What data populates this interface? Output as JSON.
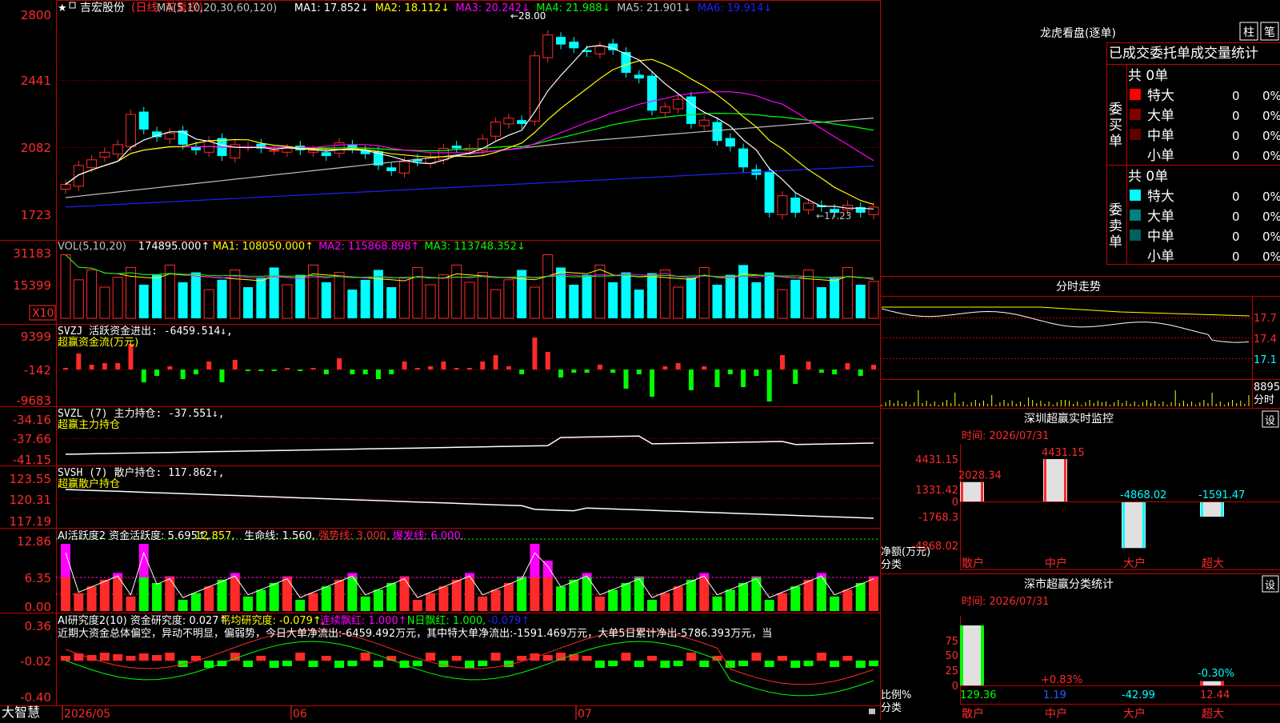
{
  "app": {
    "name": "大智慧",
    "star": "★"
  },
  "title": {
    "stock": "吉宏股份",
    "period": "(日线, 前复权)"
  },
  "dates": {
    "a": "2026/05",
    "b": "06",
    "c": "07"
  },
  "colors": {
    "up": "#ff2a2a",
    "down": "#00ffff",
    "green": "#00ff00",
    "white": "#ffffff",
    "yellow": "#ffff00",
    "magenta": "#ff00ff",
    "blue": "#2020ff",
    "grid": "#c00000",
    "grey": "#c0c0c0"
  },
  "main": {
    "legend": [
      {
        "text": "MA(5,10,20,30,60,120)",
        "color": "#c0c0c0"
      },
      {
        "text": "MA1: 17.852↓",
        "color": "#ffffff"
      },
      {
        "text": "MA2: 18.112↓",
        "color": "#ffff00"
      },
      {
        "text": "MA3: 20.242↓",
        "color": "#ff00ff"
      },
      {
        "text": "MA4: 21.988↓",
        "color": "#00ff00"
      },
      {
        "text": "MA5: 21.901↓",
        "color": "#c0c0c0"
      },
      {
        "text": "MA6: 19.914↓",
        "color": "#2020ff"
      }
    ],
    "yticks": [
      "2800",
      "2441",
      "2082",
      "1723"
    ],
    "high_label": "←28.00",
    "low_label": "←17.23"
  },
  "vol": {
    "legend": [
      {
        "text": "VOL(5,10,20)",
        "color": "#c0c0c0"
      },
      {
        "text": "174895.000↑",
        "color": "#ffffff"
      },
      {
        "text": "MA1: 108050.000↑",
        "color": "#ffff00"
      },
      {
        "text": "MA2: 115868.898↑",
        "color": "#ff00ff"
      },
      {
        "text": "MA3: 113748.352↓",
        "color": "#00ff00"
      }
    ],
    "yticks": [
      "31183",
      "15399"
    ],
    "unit": "X10"
  },
  "svzj": {
    "legend1": [
      {
        "text": "SVZJ  活跃资金进出: -6459.514↓,",
        "color": "#ffffff"
      }
    ],
    "legend2": "超赢资金流(万元)",
    "yticks": [
      "9399",
      "-142",
      "-9683"
    ]
  },
  "svzl": {
    "legend1": [
      {
        "text": "SVZL (7) 主力持仓: -37.551↓,",
        "color": "#ffffff"
      }
    ],
    "legend2": "超赢主力持仓",
    "yticks": [
      "-34.16",
      "-37.66",
      "-41.15"
    ]
  },
  "svsh": {
    "legend1": [
      {
        "text": "SVSH (7) 散户持仓: 117.862↑,",
        "color": "#ffffff"
      }
    ],
    "legend2": "超赢散户持仓",
    "yticks": [
      "123.55",
      "120.31",
      "117.19"
    ]
  },
  "ai1": {
    "legend": [
      {
        "text": "AI活跃度2 资金活跃度: 5.695↑,",
        "color": "#ffffff"
      },
      {
        "text": "12.857,",
        "color": "#ffff00"
      },
      {
        "text": "生命线: 1.560,",
        "color": "#ffffff"
      },
      {
        "text": "强势线: 3.000,",
        "color": "#ff2a2a"
      },
      {
        "text": "爆发线: 6.000,",
        "color": "#ff00ff"
      }
    ],
    "yticks": [
      "12.86",
      "6.35",
      "0.00"
    ]
  },
  "ai2": {
    "legend": [
      {
        "text": "AI研究度2(10) 资金研究度: 0.027↑,",
        "color": "#ffffff"
      },
      {
        "text": "平均研究度: -0.079↑,",
        "color": "#ffff00"
      },
      {
        "text": "连续飘红: 1.000↑,",
        "color": "#ff00ff"
      },
      {
        "text": "N日飘红: 1.000,",
        "color": "#00ff00"
      },
      {
        "text": "-0.079↑",
        "color": "#2020ff"
      }
    ],
    "text": "近期大资金总体偏空，异动不明显，偏弱势，今日大单净流出:-6459.492万元，其中特大单净流出:-1591.469万元，大单5日累计净出-5786.393万元，当",
    "yticks": [
      "0.36",
      "-0.02",
      "-0.40"
    ]
  },
  "lhb": {
    "title": "龙虎看盘(逐单)",
    "btn1": "柱",
    "btn2": "笔",
    "header": "已成交委托单成交量统计",
    "buy": {
      "label": "委买单",
      "total": "共 0单",
      "rows": [
        {
          "name": "特大",
          "v": "0",
          "p": "0%",
          "c": "#ff0000"
        },
        {
          "name": "大单",
          "v": "0",
          "p": "0%",
          "c": "#800000"
        },
        {
          "name": "中单",
          "v": "0",
          "p": "0%",
          "c": "#600000"
        },
        {
          "name": "小单",
          "v": "0",
          "p": "0%",
          "c": "#000000"
        }
      ]
    },
    "sell": {
      "label": "委卖单",
      "total": "共 0单",
      "rows": [
        {
          "name": "特大",
          "v": "0",
          "p": "0%",
          "c": "#00ffff"
        },
        {
          "name": "大单",
          "v": "0",
          "p": "0%",
          "c": "#008080"
        },
        {
          "name": "中单",
          "v": "0",
          "p": "0%",
          "c": "#006060"
        },
        {
          "name": "小单",
          "v": "0",
          "p": "0%",
          "c": "#000000"
        }
      ]
    }
  },
  "intraday": {
    "title": "分时走势",
    "p1": "17.7",
    "p2": "17.4",
    "p3": "17.1",
    "vol": "8895",
    "vlabel": "分时"
  },
  "szjk": {
    "title": "深圳超赢实时监控",
    "btn": "设",
    "time": "时间: 2026/07/31",
    "yticks": [
      "4431.15",
      "1331.42",
      "0",
      "-1768.3",
      "-4868.02"
    ],
    "ylabel": "净额(万元)",
    "xlabel": "分类",
    "cats": [
      "散户",
      "中户",
      "大户",
      "超大"
    ],
    "vals": [
      "2028.34",
      "4431.15",
      "-4868.02",
      "-1591.47"
    ]
  },
  "fltj": {
    "title": "深市超赢分类统计",
    "btn": "设",
    "time": "时间: 2026/07/31",
    "yticks": [
      "75",
      "50",
      "25",
      "0"
    ],
    "ylabel": "比例%",
    "xlabel": "分类",
    "cats": [
      "散户",
      "中户",
      "大户",
      "超大"
    ],
    "pct": [
      "",
      "+0.83%",
      "",
      "-0.30%"
    ],
    "vals": [
      "129.36",
      "1.19",
      "-42.99",
      "12.44"
    ]
  },
  "chart_data": {
    "type": "candlestick",
    "title": "吉宏股份 (日线, 前复权)",
    "x_labels": [
      "2026/05",
      "06",
      "07"
    ],
    "ylim": [
      16.5,
      28.6
    ],
    "close": [
      19.1,
      20.1,
      20.4,
      20.8,
      21.2,
      22.8,
      22.0,
      21.6,
      21.8,
      21.2,
      20.9,
      21.4,
      20.6,
      21.2,
      21.1,
      21.0,
      20.9,
      21.0,
      20.9,
      20.9,
      20.6,
      21.3,
      21.0,
      20.7,
      20.1,
      19.8,
      20.3,
      20.3,
      20.5,
      21.0,
      21.0,
      21.0,
      21.5,
      22.4,
      22.6,
      22.3,
      25.9,
      27.0,
      26.5,
      26.3,
      26.1,
      26.4,
      26.2,
      25.0,
      24.7,
      23.0,
      23.2,
      23.6,
      22.3,
      22.5,
      21.4,
      21.1,
      20.0,
      19.6,
      17.6,
      18.5,
      17.6,
      18.1,
      17.9,
      17.6,
      18.0,
      17.6,
      17.9
    ],
    "vol_labels": [
      "31183",
      "15399"
    ]
  }
}
